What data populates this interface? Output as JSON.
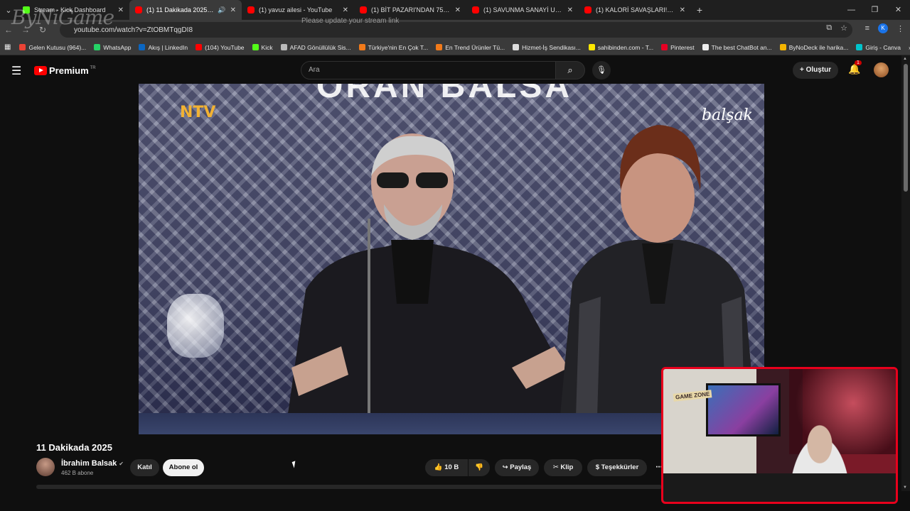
{
  "browser": {
    "tabs": [
      {
        "title": "Stream - Kick Dashboard",
        "favicon": "kick-icon",
        "active": false
      },
      {
        "title": "(1) 11 Dakikada 2025 - YouTube",
        "favicon": "youtube-icon",
        "active": true,
        "audio": true
      },
      {
        "title": "(1) yavuz ailesi - YouTube",
        "favicon": "youtube-icon",
        "active": false
      },
      {
        "title": "(1) BİT PAZARI'NDAN 7500 TL İ...",
        "favicon": "youtube-icon",
        "active": false
      },
      {
        "title": "(1) SAVUNMA SANAYİ UZMANI...",
        "favicon": "youtube-icon",
        "active": false
      },
      {
        "title": "(1) KALORİ SAVAŞLARI! 1. BÖLÜ...",
        "favicon": "youtube-icon",
        "active": false
      }
    ],
    "url": "youtube.com/watch?v=ZtOBMTqgDI8",
    "warning": "Please update your stream link",
    "profile_initial": "K",
    "bookmarks": [
      {
        "label": "Gelen Kutusu (964)...",
        "color": "#ea4335"
      },
      {
        "label": "WhatsApp",
        "color": "#25d366"
      },
      {
        "label": "Akış | LinkedIn",
        "color": "#0a66c2"
      },
      {
        "label": "(104) YouTube",
        "color": "#ff0000"
      },
      {
        "label": "Kick",
        "color": "#53fc18"
      },
      {
        "label": "AFAD Gönüllülük Sis...",
        "color": "#bbbbbb"
      },
      {
        "label": "Türkiye'nin En Çok T...",
        "color": "#f27a1a"
      },
      {
        "label": "En Trend Ürünler Tü...",
        "color": "#f27a1a"
      },
      {
        "label": "Hizmet-İş Sendikası...",
        "color": "#dddddd"
      },
      {
        "label": "sahibinden.com - T...",
        "color": "#ffe800"
      },
      {
        "label": "Pinterest",
        "color": "#e60023"
      },
      {
        "label": "The best ChatBot an...",
        "color": "#eeeeee"
      },
      {
        "label": "ByNoDeck ile harika...",
        "color": "#f4b400"
      },
      {
        "label": "Giriş - Canva",
        "color": "#00c4cc"
      }
    ]
  },
  "youtube": {
    "logo_text": "Premium",
    "region": "TR",
    "search_placeholder": "Ara",
    "create_label": "Oluştur",
    "notification_count": "1"
  },
  "video": {
    "overlay_brand": "NTV",
    "overlay_signature": "balşak",
    "title": "11 Dakikada 2025",
    "channel": "İbrahim Balsak",
    "subscribers": "462 B abone",
    "join_label": "Katıl",
    "subscribe_label": "Abone ol",
    "likes": "10 B",
    "share_label": "Paylaş",
    "clip_label": "Klip",
    "thanks_label": "Teşekkürler"
  },
  "webcam": {
    "watermark": "ByNiGame",
    "sign_text": "GAME ZONE"
  }
}
